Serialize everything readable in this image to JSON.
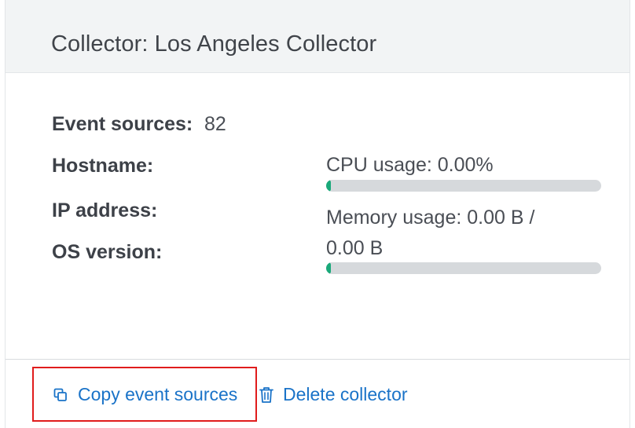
{
  "header": {
    "title": "Collector: Los Angeles Collector"
  },
  "details": {
    "event_sources_label": "Event sources:",
    "event_sources_value": "82",
    "hostname_label": "Hostname:",
    "ip_label": "IP address:",
    "os_label": "OS version:"
  },
  "metrics": {
    "cpu_label": "CPU usage: 0.00%",
    "cpu_fraction": 0.0,
    "memory_label_line1": "Memory usage: 0.00 B /",
    "memory_label_line2": "0.00 B",
    "memory_fraction": 0.0
  },
  "actions": {
    "copy_label": "Copy event sources",
    "copy_icon": "copy-icon",
    "delete_label": "Delete collector",
    "delete_icon": "trash-icon"
  },
  "colors": {
    "accent": "#1a73c8",
    "progress": "#1aa97a",
    "highlight": "#e01c1c"
  }
}
